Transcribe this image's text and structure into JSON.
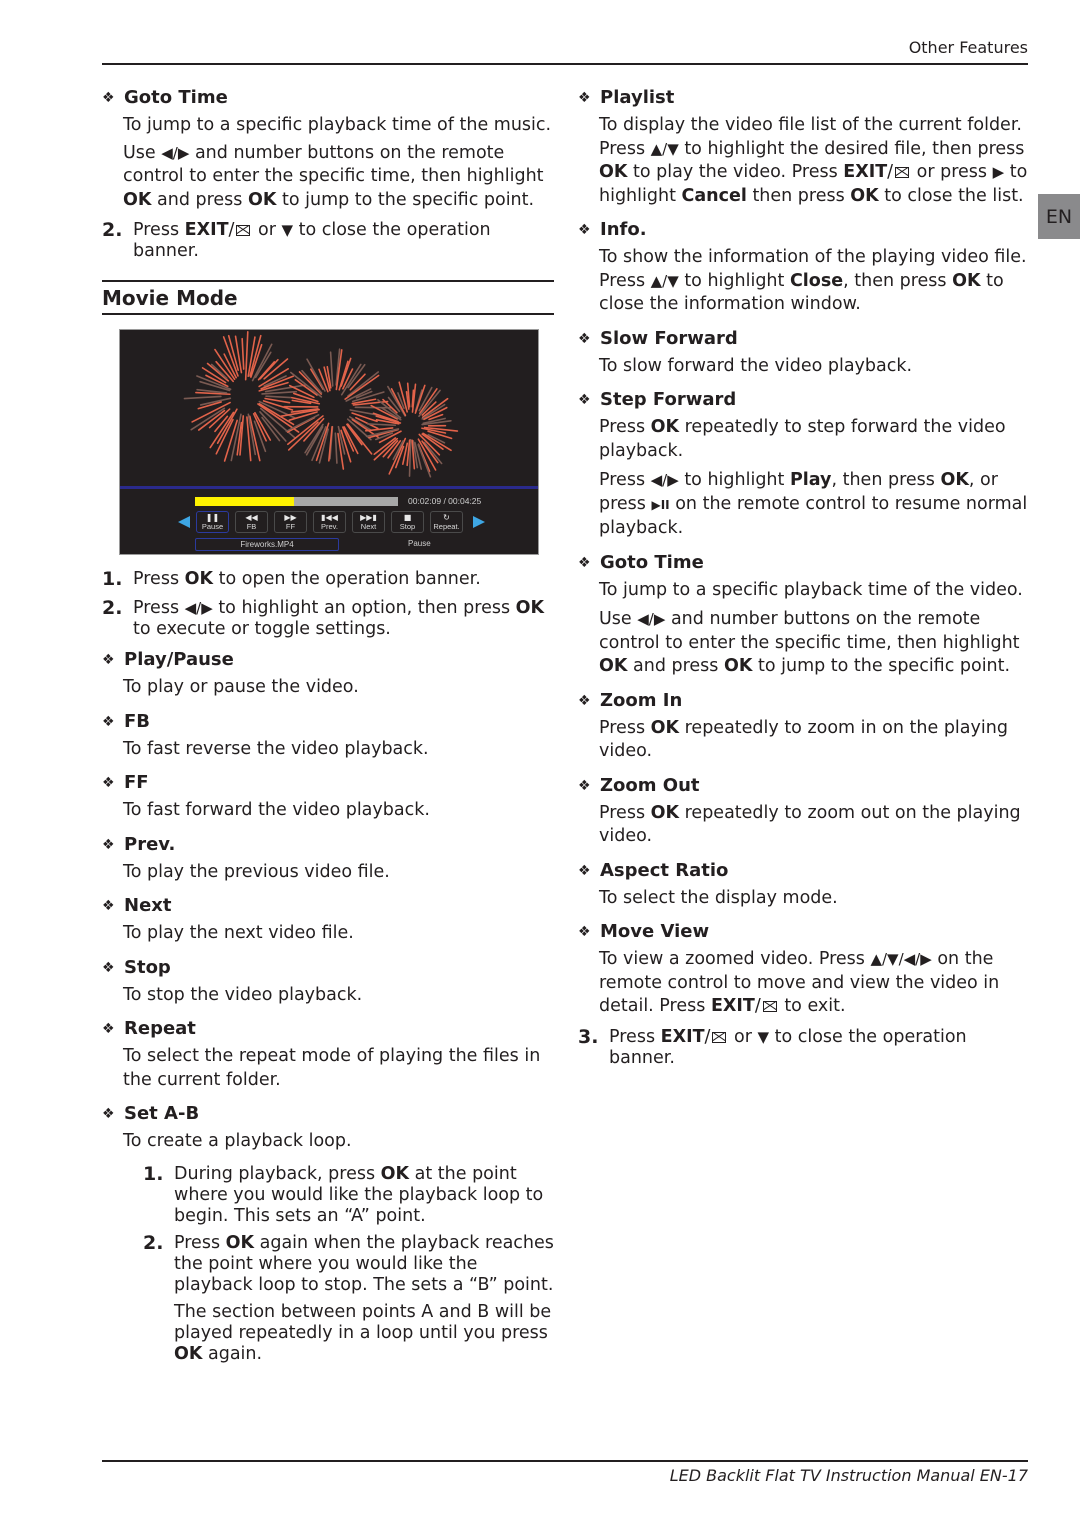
{
  "page": {
    "header": "Other Features",
    "footer": "LED Backlit Flat TV Instruction Manual   EN-17",
    "language_tab": "EN"
  },
  "left": {
    "goto_time_music": {
      "title": "Goto Time",
      "p1": "To jump to a specific playback time of the music.",
      "p2_a": "Use ",
      "p2_b": " and number buttons on the remote control to enter the specific time, then highlight ",
      "p2_ok1": "OK",
      "p2_c": " and press ",
      "p2_ok2": "OK",
      "p2_d": " to jump to the specific point."
    },
    "music_step2": {
      "num": "2.",
      "a": "Press ",
      "exit": "EXIT",
      "b": " or ",
      "c": " to close the operation banner."
    },
    "section_title": "Movie Mode",
    "player": {
      "progress_fraction": 0.487,
      "time": "00:02:09 / 00:04:25",
      "buttons": [
        {
          "label": "Pause",
          "icon": "pause-icon",
          "glyph": "❚❚",
          "active": true
        },
        {
          "label": "FB",
          "icon": "fast-backward-icon",
          "glyph": "◀◀",
          "active": false
        },
        {
          "label": "FF",
          "icon": "fast-forward-icon",
          "glyph": "▶▶",
          "active": false
        },
        {
          "label": "Prev.",
          "icon": "previous-icon",
          "glyph": "▮◀◀",
          "active": false
        },
        {
          "label": "Next",
          "icon": "next-icon",
          "glyph": "▶▶▮",
          "active": false
        },
        {
          "label": "Stop",
          "icon": "stop-icon",
          "glyph": "■",
          "active": false
        },
        {
          "label": "Repeat.",
          "icon": "repeat-icon",
          "glyph": "↻",
          "active": false
        }
      ],
      "filename": "Fireworks.MP4",
      "status": "Pause",
      "colors": {
        "progress": "#fff200",
        "track": "#a7a7a7",
        "highlight": "#2b3a9e",
        "arrows": "#3ea6e4",
        "firework": "#e2634a"
      }
    },
    "step1": {
      "num": "1.",
      "a": "Press ",
      "ok": "OK",
      "b": " to open the operation banner."
    },
    "step2": {
      "num": "2.",
      "a": "Press ",
      "b": " to highlight an option, then press ",
      "ok": "OK",
      "c": " to execute or toggle settings."
    },
    "features": [
      {
        "title": "Play/Pause",
        "desc": "To play or pause the video."
      },
      {
        "title": "FB",
        "desc": "To fast reverse the video playback."
      },
      {
        "title": "FF",
        "desc": "To fast forward the video playback."
      },
      {
        "title": "Prev.",
        "desc": "To play the previous video file."
      },
      {
        "title": "Next",
        "desc": "To play the next video file."
      },
      {
        "title": "Stop",
        "desc": "To stop the video playback."
      },
      {
        "title": "Repeat",
        "desc": "To select the repeat mode of playing the files in the current folder."
      }
    ],
    "set_ab": {
      "title": "Set A-B",
      "desc": "To create a playback loop.",
      "s1": {
        "num": "1.",
        "a": "During playback, press ",
        "ok": "OK",
        "b": " at the point where you would like the playback loop to begin. This sets an “A” point."
      },
      "s2": {
        "num": "2.",
        "a": "Press ",
        "ok": "OK",
        "b": " again when the playback reaches the point where you would like the playback loop to stop. The sets a “B” point."
      },
      "note": {
        "a": "The section between points A and B will be played repeatedly in a loop until you press ",
        "ok": "OK",
        "b": " again."
      }
    }
  },
  "right": {
    "playlist": {
      "title": "Playlist",
      "a": "To display the video file list of the current folder. Press ",
      "b": " to highlight the desired file, then press ",
      "ok1": "OK",
      "c": " to play the video. Press ",
      "exit": "EXIT",
      "d": " or press ",
      "e": " to highlight ",
      "cancel": "Cancel",
      "f": " then press ",
      "ok2": "OK",
      "g": " to close the list."
    },
    "info": {
      "title": "Info.",
      "a": "To show the information of the playing video file. Press ",
      "b": " to highlight ",
      "close": "Close",
      "c": ", then press ",
      "ok": "OK",
      "d": " to close the information window."
    },
    "slow_forward": {
      "title": "Slow Forward",
      "desc": "To slow forward the video playback."
    },
    "step_forward": {
      "title": "Step Forward",
      "p1_a": "Press ",
      "p1_ok": "OK",
      "p1_b": " repeatedly to step forward the video playback.",
      "p2_a": "Press ",
      "p2_b": " to highlight ",
      "p2_play": "Play",
      "p2_c": ", then press ",
      "p2_ok": "OK",
      "p2_d": ", or press ",
      "p2_e": " on the remote control to resume normal playback."
    },
    "goto_time": {
      "title": "Goto Time",
      "p1": "To jump to a specific playback time of the video.",
      "p2_a": "Use ",
      "p2_b": " and number buttons on the remote control to enter the specific time, then highlight ",
      "p2_ok1": "OK",
      "p2_c": " and press ",
      "p2_ok2": "OK",
      "p2_d": " to jump to the specific point."
    },
    "zoom_in": {
      "title": "Zoom In",
      "a": "Press ",
      "ok": "OK",
      "b": " repeatedly to zoom in on the playing video."
    },
    "zoom_out": {
      "title": "Zoom Out",
      "a": "Press ",
      "ok": "OK",
      "b": " repeatedly to zoom out on the playing video."
    },
    "aspect_ratio": {
      "title": "Aspect Ratio",
      "desc": "To select the display mode."
    },
    "move_view": {
      "title": "Move View",
      "a": "To view a zoomed video. Press ",
      "b": " on the remote control to move and view the video in detail. Press ",
      "exit": "EXIT",
      "c": " to exit."
    },
    "step3": {
      "num": "3.",
      "a": "Press ",
      "exit": "EXIT",
      "b": " or ",
      "c": " to close the operation banner."
    }
  },
  "symbols": {
    "bullet": "❖",
    "left_right": "◀/▶",
    "up_down": "▲/▼",
    "all_dirs": "▲/▼/◀/▶",
    "down": "▼",
    "right": "▶",
    "play_pause": "▶II",
    "slash": "/"
  }
}
